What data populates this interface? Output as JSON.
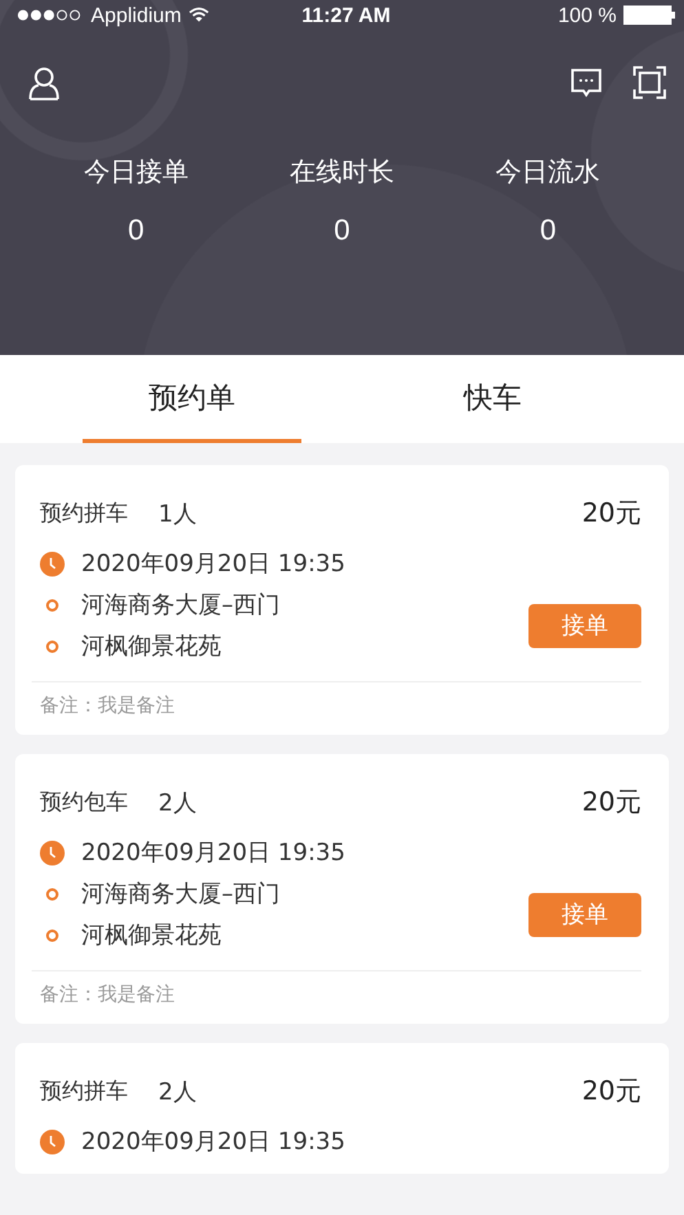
{
  "status_bar": {
    "carrier": "Applidium",
    "time": "11:27 AM",
    "battery": "100 %"
  },
  "stats": [
    {
      "label": "今日接单",
      "value": "0"
    },
    {
      "label": "在线时长",
      "value": "0"
    },
    {
      "label": "今日流水",
      "value": "0"
    }
  ],
  "tabs": [
    {
      "label": "预约单",
      "selected": true
    },
    {
      "label": "快车",
      "selected": false
    }
  ],
  "orders": [
    {
      "type": "预约拼车",
      "people": "1人",
      "price": "20元",
      "time": "2020年09月20日 19:35",
      "from": "河海商务大厦–西门",
      "to": "河枫御景花苑",
      "action": "接单",
      "note": "备注：我是备注"
    },
    {
      "type": "预约包车",
      "people": "2人",
      "price": "20元",
      "time": "2020年09月20日 19:35",
      "from": "河海商务大厦–西门",
      "to": "河枫御景花苑",
      "action": "接单",
      "note": "备注：我是备注"
    },
    {
      "type": "预约拼车",
      "people": "2人",
      "price": "20元",
      "time": "2020年09月20日 19:35"
    }
  ]
}
